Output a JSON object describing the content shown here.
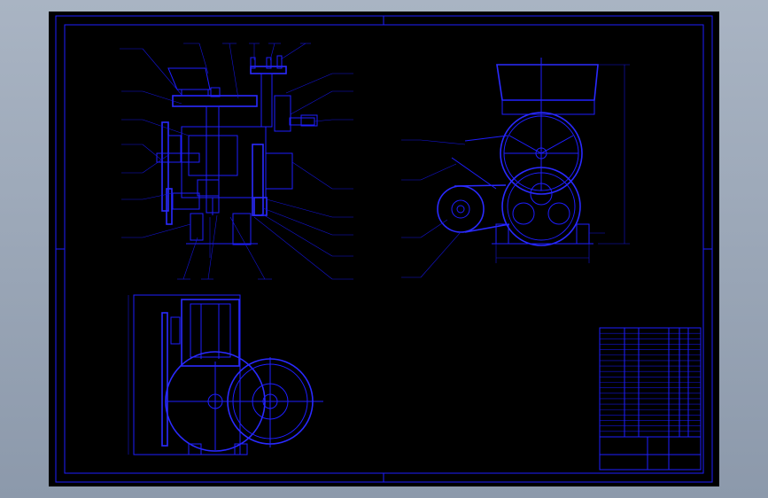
{
  "drawing": {
    "frame_color": "#1e1eff",
    "background": "#000000",
    "views": [
      "front-section-view",
      "side-view",
      "top-view"
    ],
    "title_block": {
      "rows": 20,
      "cols": 6
    }
  }
}
